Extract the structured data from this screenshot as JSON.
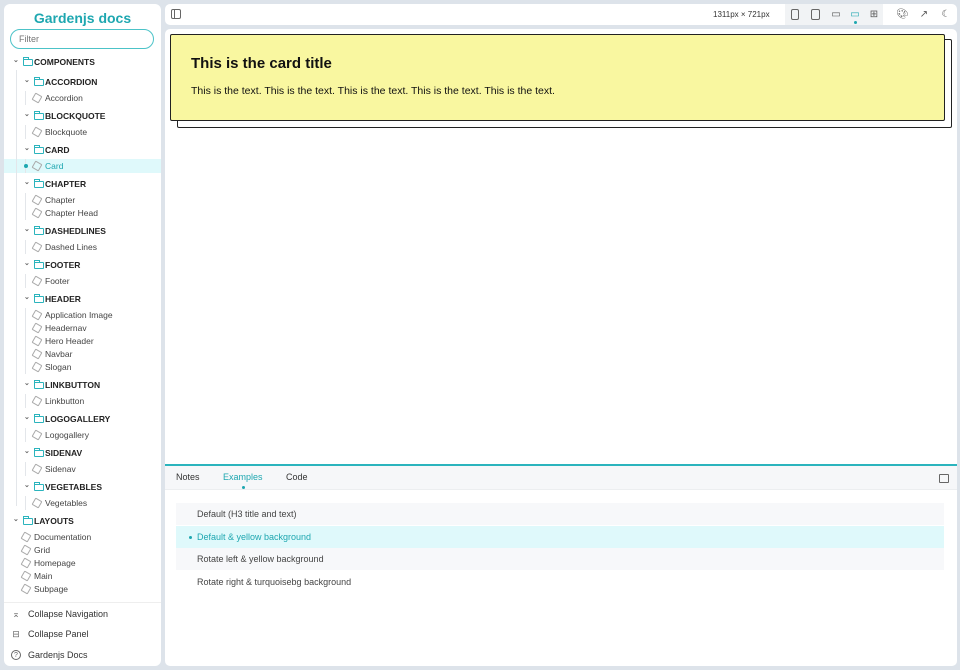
{
  "sidebar": {
    "title": "Gardenjs docs",
    "filter_placeholder": "Filter",
    "tree": [
      {
        "type": "folder",
        "level": 0,
        "label": "COMPONENTS"
      },
      {
        "type": "folder",
        "level": 1,
        "label": "ACCORDION"
      },
      {
        "type": "item",
        "level": 2,
        "label": "Accordion"
      },
      {
        "type": "folder",
        "level": 1,
        "label": "BLOCKQUOTE"
      },
      {
        "type": "item",
        "level": 2,
        "label": "Blockquote"
      },
      {
        "type": "folder",
        "level": 1,
        "label": "CARD"
      },
      {
        "type": "item",
        "level": 2,
        "label": "Card",
        "selected": true
      },
      {
        "type": "folder",
        "level": 1,
        "label": "CHAPTER"
      },
      {
        "type": "item",
        "level": 2,
        "label": "Chapter"
      },
      {
        "type": "item",
        "level": 2,
        "label": "Chapter Head"
      },
      {
        "type": "folder",
        "level": 1,
        "label": "DASHEDLINES"
      },
      {
        "type": "item",
        "level": 2,
        "label": "Dashed Lines"
      },
      {
        "type": "folder",
        "level": 1,
        "label": "FOOTER"
      },
      {
        "type": "item",
        "level": 2,
        "label": "Footer"
      },
      {
        "type": "folder",
        "level": 1,
        "label": "HEADER"
      },
      {
        "type": "item",
        "level": 2,
        "label": "Application Image"
      },
      {
        "type": "item",
        "level": 2,
        "label": "Headernav"
      },
      {
        "type": "item",
        "level": 2,
        "label": "Hero Header"
      },
      {
        "type": "item",
        "level": 2,
        "label": "Navbar"
      },
      {
        "type": "item",
        "level": 2,
        "label": "Slogan"
      },
      {
        "type": "folder",
        "level": 1,
        "label": "LINKBUTTON"
      },
      {
        "type": "item",
        "level": 2,
        "label": "Linkbutton"
      },
      {
        "type": "folder",
        "level": 1,
        "label": "LOGOGALLERY"
      },
      {
        "type": "item",
        "level": 2,
        "label": "Logogallery"
      },
      {
        "type": "folder",
        "level": 1,
        "label": "SIDENAV"
      },
      {
        "type": "item",
        "level": 2,
        "label": "Sidenav"
      },
      {
        "type": "folder",
        "level": 1,
        "label": "VEGETABLES"
      },
      {
        "type": "item",
        "level": 2,
        "label": "Vegetables"
      },
      {
        "type": "folder",
        "level": 0,
        "label": "LAYOUTS"
      },
      {
        "type": "item",
        "level": 1,
        "label": "Documentation"
      },
      {
        "type": "item",
        "level": 1,
        "label": "Grid"
      },
      {
        "type": "item",
        "level": 1,
        "label": "Homepage"
      },
      {
        "type": "item",
        "level": 1,
        "label": "Main"
      },
      {
        "type": "item",
        "level": 1,
        "label": "Subpage"
      }
    ],
    "bottom": [
      {
        "icon": "collapse-navigation-icon",
        "glyph": "⌅",
        "label": "Collapse Navigation"
      },
      {
        "icon": "collapse-panel-icon",
        "glyph": "⊟",
        "label": "Collapse Panel"
      },
      {
        "icon": "help-icon",
        "glyph": "?",
        "label": "Gardenjs Docs"
      }
    ]
  },
  "toolbar": {
    "viewport_size": "1311px × 721px",
    "active_viewport": "desktop",
    "accent": "#1ea7b0"
  },
  "preview": {
    "card_title": "This is the card title",
    "card_text": "This is the text. This is the text. This is the text. This is the text. This is the text.",
    "card_bg": "#f9f7a0"
  },
  "panel": {
    "tabs": [
      "Notes",
      "Examples",
      "Code"
    ],
    "active_tab": "Examples",
    "examples": [
      "Default (H3 title and text)",
      "Default & yellow background",
      "Rotate left & yellow background",
      "Rotate right & turquoisebg background"
    ],
    "selected_example": 1
  }
}
